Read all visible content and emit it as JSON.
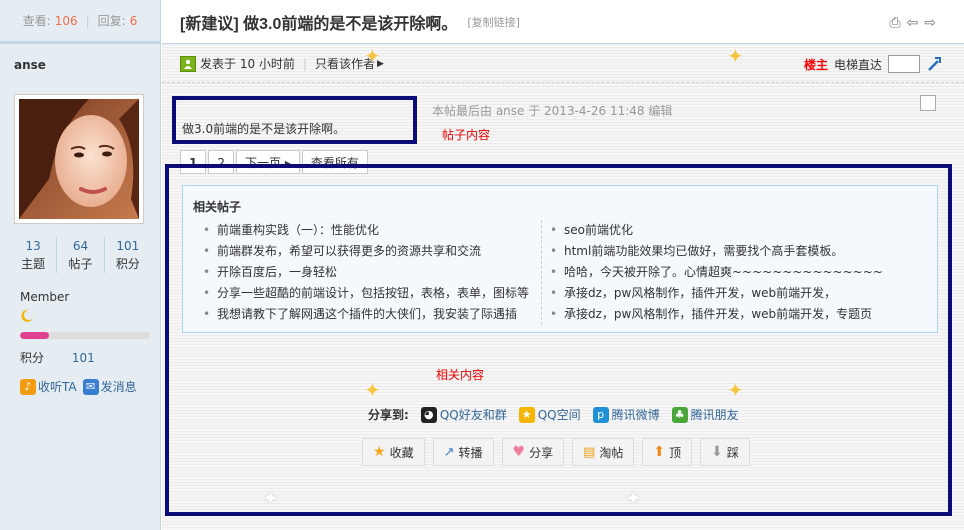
{
  "sidebar": {
    "views_label": "查看:",
    "views": "106",
    "replies_label": "回复:",
    "replies": "6",
    "username": "anse",
    "stats": [
      {
        "value": "13",
        "label": "主题"
      },
      {
        "value": "64",
        "label": "帖子"
      },
      {
        "value": "101",
        "label": "积分"
      }
    ],
    "group": "Member",
    "level_progress": 0.22,
    "points_label": "积分",
    "points_value": "101",
    "follow": "收听TA",
    "message": "发消息"
  },
  "thread": {
    "title": "[新建议] 做3.0前端的是不是该开除啊。",
    "copy_link": "[复制链接]",
    "posted": "发表于 10 小时前",
    "author_only": "只看该作者",
    "floor_owner": "楼主",
    "elevator": "电梯直达",
    "edit_note": "本帖最后由 anse 于 2013-4-26 11:48 编辑",
    "content": "做3.0前端的是不是该开除啊。",
    "annot_post": "帖子内容",
    "annot_related": "相关内容"
  },
  "pager": [
    "1",
    "2",
    "下一页 ▸",
    "查看所有"
  ],
  "related": {
    "title": "相关帖子",
    "left": [
      "前端重构实践（一）：性能优化",
      "前端群发布，希望可以获得更多的资源共享和交流",
      "开除百度后，一身轻松",
      "分享一些超酷的前端设计，包括按钮，表格，表单，图标等",
      "我想请教下了解网遇这个插件的大侠们，我安装了际遇插"
    ],
    "right": [
      "seo前端优化",
      "html前端功能效果均已做好，需要找个高手套模板。",
      "哈哈，今天被开除了。心情超爽~~~~~~~~~~~~~~~",
      "承接dz，pw风格制作，插件开发，web前端开发，",
      "承接dz，pw风格制作，插件开发，web前端开发，专题页"
    ]
  },
  "share": {
    "label": "分享到:",
    "items": [
      "QQ好友和群",
      "QQ空间",
      "腾讯微博",
      "腾讯朋友"
    ]
  },
  "actions": [
    "收藏",
    "转播",
    "分享",
    "淘帖",
    "顶",
    "踩"
  ],
  "colors": {
    "accent_blue": "#336699",
    "annotation_border": "#0b0b7a",
    "annotation_text": "#ee0000",
    "sidebar_bg": "#e5edf2"
  }
}
